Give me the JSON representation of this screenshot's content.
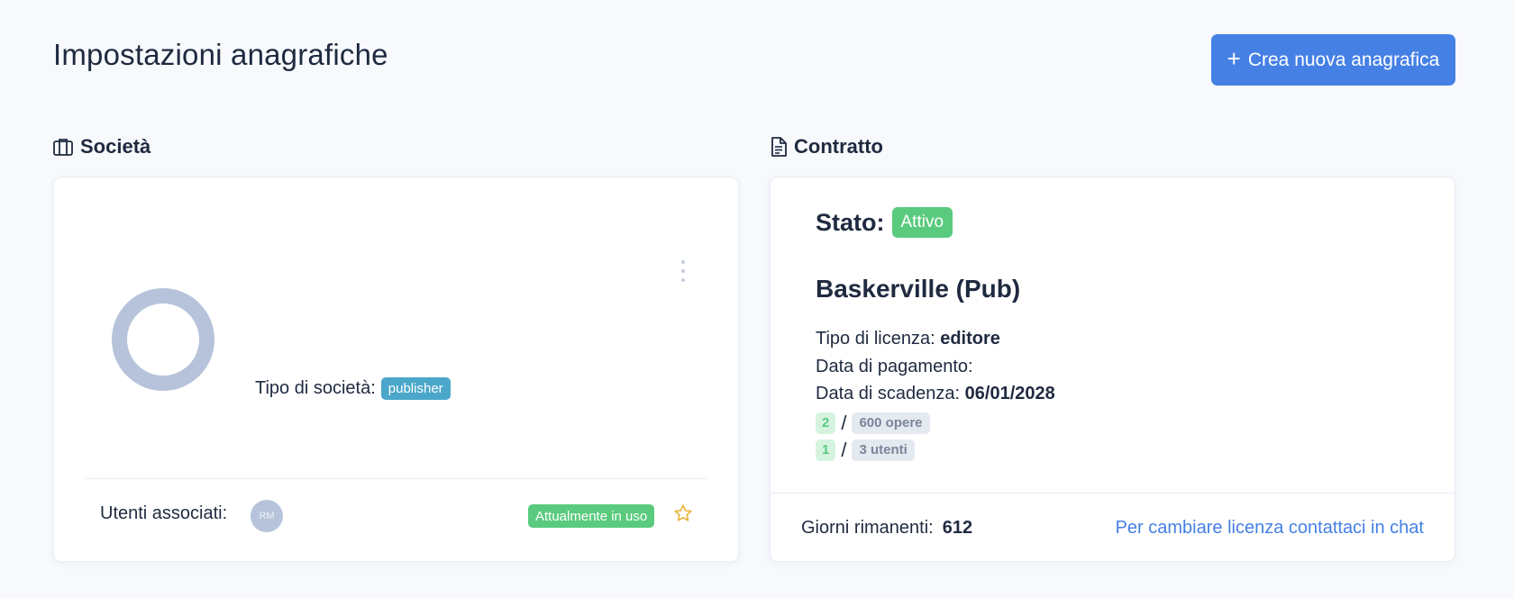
{
  "header": {
    "title": "Impostazioni anagrafiche",
    "create_button": "Crea nuova anagrafica"
  },
  "colors": {
    "primary": "#4580e5",
    "success": "#5acb7e",
    "info": "#4ba7c9",
    "muted": "#b6c3da"
  },
  "societa": {
    "section_title": "Società",
    "tipo_label": "Tipo di società:",
    "tipo_value": "publisher",
    "utenti_label": "Utenti associati:",
    "user_initials": "RM",
    "in_use_badge": "Attualmente in uso"
  },
  "contratto": {
    "section_title": "Contratto",
    "stato_label": "Stato:",
    "stato_value": "Attivo",
    "name": "Baskerville (Pub)",
    "licenza_label": "Tipo di licenza:",
    "licenza_value": "editore",
    "pagamento_label": "Data di pagamento:",
    "scadenza_label": "Data di scadenza:",
    "scadenza_value": "06/01/2028",
    "opere_used": "2",
    "opere_total": "600 opere",
    "utenti_used": "1",
    "utenti_total": "3 utenti",
    "separator": "/",
    "giorni_label": "Giorni rimanenti:",
    "giorni_value": "612",
    "cambia_link": "Per cambiare licenza contattaci in chat"
  }
}
